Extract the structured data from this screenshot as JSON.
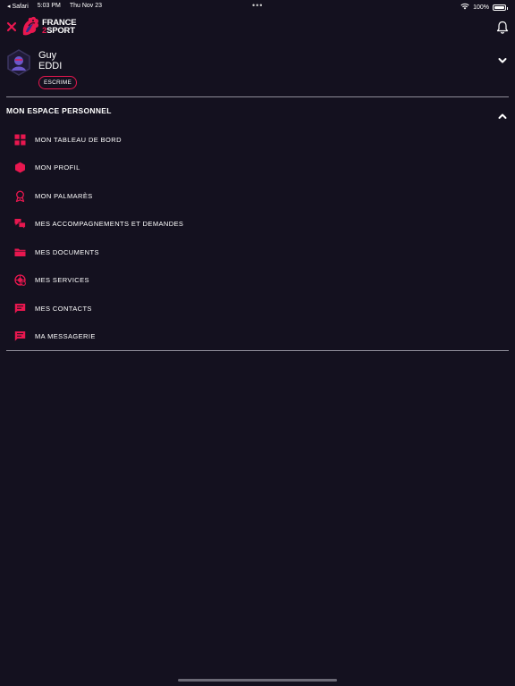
{
  "status_bar": {
    "back_app": "◂ Safari",
    "time": "5:03 PM",
    "date": "Thu Nov 23",
    "dots": "•••",
    "battery_pct": "100%"
  },
  "brand": {
    "line1": "FRANCE",
    "line2_accent": "2",
    "line2": "SPORT",
    "accent_color": "#e8174f"
  },
  "profile": {
    "first_name": "Guy",
    "last_name": "EDDI",
    "sport": "ESCRIME"
  },
  "section": {
    "title": "MON ESPACE PERSONNEL",
    "expanded": true
  },
  "menu": {
    "items": [
      {
        "label": "MON TABLEAU DE BORD",
        "icon": "dashboard-icon"
      },
      {
        "label": "MON PROFIL",
        "icon": "hexagon-profile-icon"
      },
      {
        "label": "MON PALMARÈS",
        "icon": "medal-icon"
      },
      {
        "label": "MES ACCOMPAGNEMENTS ET DEMANDES",
        "icon": "chat-bubbles-icon"
      },
      {
        "label": "MES DOCUMENTS",
        "icon": "folder-icon"
      },
      {
        "label": "MES SERVICES",
        "icon": "services-icon"
      },
      {
        "label": "MES CONTACTS",
        "icon": "message-icon"
      },
      {
        "label": "MA MESSAGERIE",
        "icon": "message-icon"
      }
    ]
  }
}
